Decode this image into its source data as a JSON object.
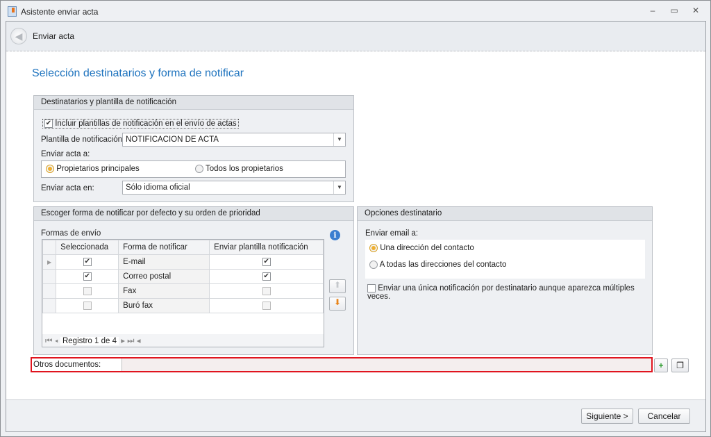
{
  "window": {
    "title": "Asistente enviar acta",
    "minimize": "–",
    "maximize": "▭",
    "close": "✕"
  },
  "header": {
    "title": "Enviar acta"
  },
  "page_title": "Selección destinatarios y forma de notificar",
  "group1": {
    "title": "Destinatarios y plantilla de notificación",
    "include_label": "Incluir plantillas de notificación en el envío de actas",
    "include_checked": true,
    "plantilla_label": "Plantilla de notificación:",
    "plantilla_value": "NOTIFICACION DE ACTA",
    "enviar_a_label": "Enviar acta a:",
    "radio1": "Propietarios principales",
    "radio2": "Todos los propietarios",
    "enviar_en_label": "Enviar acta en:",
    "enviar_en_value": "Sólo idioma oficial"
  },
  "group2": {
    "title": "Escoger forma de notificar por defecto y su orden de prioridad",
    "formas_label": "Formas de envío",
    "columns": [
      "Seleccionada",
      "Forma de notificar",
      "Enviar plantilla notificación"
    ],
    "rows": [
      {
        "sel": true,
        "forma": "E-mail",
        "plantilla": true
      },
      {
        "sel": true,
        "forma": "Correo postal",
        "plantilla": true
      },
      {
        "sel": false,
        "forma": "Fax",
        "plantilla": false
      },
      {
        "sel": false,
        "forma": "Buró fax",
        "plantilla": false
      }
    ],
    "navigator": "Registro 1 de 4"
  },
  "group3": {
    "title": "Opciones destinatario",
    "email_label": "Enviar email a:",
    "radio1": "Una dirección del contacto",
    "radio2": "A todas las direcciones del contacto",
    "unica_label": "Enviar una única notificación por destinatario aunque aparezca múltiples veces."
  },
  "otros": {
    "label": "Otros documentos:",
    "value": ""
  },
  "footer": {
    "next": "Siguiente >",
    "cancel": "Cancelar"
  }
}
